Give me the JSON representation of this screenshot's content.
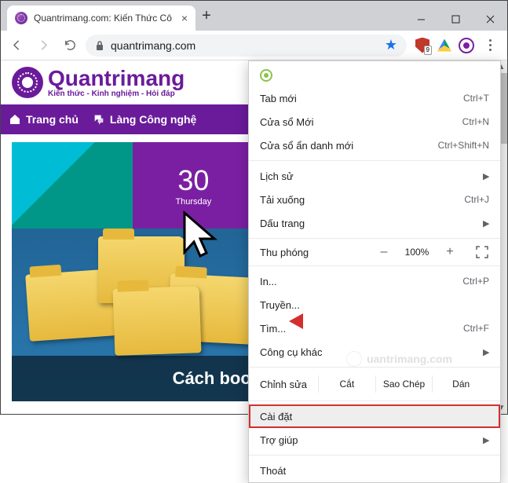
{
  "window": {
    "tab_title": "Quantrimang.com: Kiến Thức Cô",
    "minimize": "–",
    "maximize": "□",
    "close": "×"
  },
  "toolbar": {
    "url": "quantrimang.com",
    "adblock_badge": "9"
  },
  "site": {
    "logo_main": "uantrimang",
    "logo_prefix": "Q",
    "logo_tagline": "Kiến thức - Kinh nghiệm - Hỏi đáp",
    "nav_home": "Trang chủ",
    "nav_tech": "Làng Công nghệ",
    "hero_caption": "Cách bookmark thư",
    "calendar_num": "30",
    "calendar_day": "Thursday"
  },
  "menu": {
    "new_tab": {
      "label": "Tab mới",
      "shortcut": "Ctrl+T"
    },
    "new_window": {
      "label": "Cửa sổ Mới",
      "shortcut": "Ctrl+N"
    },
    "incognito": {
      "label": "Cửa sổ ẩn danh mới",
      "shortcut": "Ctrl+Shift+N"
    },
    "history": {
      "label": "Lịch sử"
    },
    "downloads": {
      "label": "Tải xuống",
      "shortcut": "Ctrl+J"
    },
    "bookmarks": {
      "label": "Dấu trang"
    },
    "zoom": {
      "label": "Thu phóng",
      "minus": "–",
      "value": "100%",
      "plus": "+"
    },
    "print": {
      "label": "In...",
      "shortcut": "Ctrl+P"
    },
    "cast": {
      "label": "Truyền..."
    },
    "find": {
      "label": "Tìm...",
      "shortcut": "Ctrl+F"
    },
    "more_tools": {
      "label": "Công cụ khác"
    },
    "edit": {
      "label": "Chỉnh sửa",
      "cut": "Cắt",
      "copy": "Sao Chép",
      "paste": "Dán"
    },
    "settings": {
      "label": "Cài đặt"
    },
    "help": {
      "label": "Trợ giúp"
    },
    "exit": {
      "label": "Thoát"
    }
  },
  "watermark": "uantrimang.com"
}
